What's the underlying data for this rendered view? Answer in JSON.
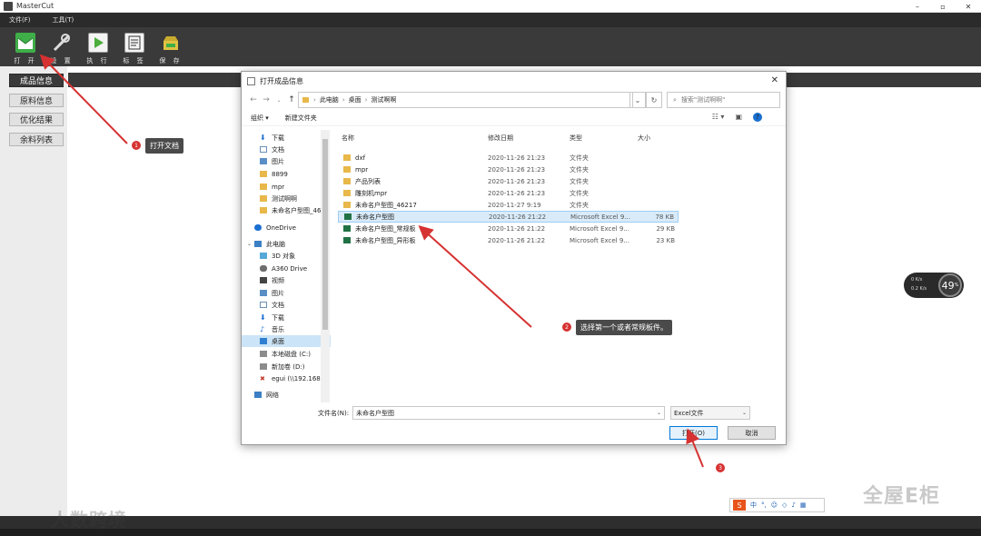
{
  "window": {
    "title": "MasterCut",
    "controls": [
      "–",
      "▫",
      "✕"
    ]
  },
  "menu": {
    "items": [
      "文件(F)",
      "工具(T)"
    ]
  },
  "toolbar": {
    "items": [
      {
        "label": "打 开",
        "icon": "open-icon",
        "color": "#3fae49"
      },
      {
        "label": "设 置",
        "icon": "tools-icon",
        "color": "#d9d9d9"
      },
      {
        "label": "执 行",
        "icon": "play-icon",
        "color": "#5fbf4a"
      },
      {
        "label": "标 签",
        "icon": "label-icon",
        "color": "#d9d9d9"
      },
      {
        "label": "保 存",
        "icon": "save-icon",
        "color": "#e0c341"
      }
    ]
  },
  "leftnav": {
    "items": [
      "成品信息",
      "原料信息",
      "优化结果",
      "余料列表"
    ]
  },
  "annotations": {
    "open_doc": "打开文档",
    "select_first": "选择第一个或者常规板件。",
    "step1": "1",
    "step2": "2",
    "step3": "3"
  },
  "gauge": {
    "up": "0",
    "up_unit": "K/s",
    "down": "0.2",
    "down_unit": "K/s",
    "percent": "49",
    "percent_unit": "%"
  },
  "dialog": {
    "title": "打开成品信息",
    "breadcrumbs": [
      "此电脑",
      "桌面",
      "测试啊啊"
    ],
    "search_placeholder": "搜索\"测试啊啊\"",
    "organize": "组织 ▾",
    "new_folder": "新建文件夹",
    "nav": [
      {
        "label": "下载",
        "icon": "download-icon",
        "pinned": true
      },
      {
        "label": "文档",
        "icon": "document-icon",
        "pinned": true
      },
      {
        "label": "图片",
        "icon": "picture-icon",
        "pinned": true
      },
      {
        "label": "8899",
        "icon": "folder-icon",
        "pinned": false
      },
      {
        "label": "mpr",
        "icon": "folder-icon",
        "pinned": false
      },
      {
        "label": "测试啊啊",
        "icon": "folder-icon",
        "pinned": false
      },
      {
        "label": "未命名户型图_46",
        "icon": "folder-icon",
        "pinned": false
      },
      {
        "label": "OneDrive",
        "icon": "cloud-icon",
        "pinned": false
      },
      {
        "label": "此电脑",
        "icon": "computer-icon",
        "pinned": false
      },
      {
        "label": "3D 对象",
        "icon": "cube-icon",
        "pinned": false
      },
      {
        "label": "A360 Drive",
        "icon": "drive-icon",
        "pinned": false
      },
      {
        "label": "视频",
        "icon": "video-icon",
        "pinned": false
      },
      {
        "label": "图片",
        "icon": "picture-icon",
        "pinned": false
      },
      {
        "label": "文档",
        "icon": "document-icon",
        "pinned": false
      },
      {
        "label": "下载",
        "icon": "download-icon",
        "pinned": false
      },
      {
        "label": "音乐",
        "icon": "music-icon",
        "pinned": false
      },
      {
        "label": "桌面",
        "icon": "desktop-icon",
        "pinned": false
      },
      {
        "label": "本地磁盘 (C:)",
        "icon": "disk-icon",
        "pinned": false
      },
      {
        "label": "新加卷 (D:)",
        "icon": "disk-icon",
        "pinned": false
      },
      {
        "label": "egui (\\\\192.168.",
        "icon": "network-drive-icon",
        "pinned": false
      },
      {
        "label": "网络",
        "icon": "network-icon",
        "pinned": false
      }
    ],
    "columns": {
      "name": "名称",
      "date": "修改日期",
      "type": "类型",
      "size": "大小"
    },
    "files": [
      {
        "name": "dxf",
        "date": "2020-11-26 21:23",
        "type": "文件夹",
        "size": "",
        "kind": "folder"
      },
      {
        "name": "mpr",
        "date": "2020-11-26 21:23",
        "type": "文件夹",
        "size": "",
        "kind": "folder"
      },
      {
        "name": "产品列表",
        "date": "2020-11-26 21:23",
        "type": "文件夹",
        "size": "",
        "kind": "folder"
      },
      {
        "name": "雕刻机mpr",
        "date": "2020-11-26 21:23",
        "type": "文件夹",
        "size": "",
        "kind": "folder"
      },
      {
        "name": "未命名户型图_46217",
        "date": "2020-11-27 9:19",
        "type": "文件夹",
        "size": "",
        "kind": "folder"
      },
      {
        "name": "未命名户型图",
        "date": "2020-11-26 21:22",
        "type": "Microsoft Excel 9...",
        "size": "78 KB",
        "kind": "excel"
      },
      {
        "name": "未命名户型图_常规板",
        "date": "2020-11-26 21:22",
        "type": "Microsoft Excel 9...",
        "size": "29 KB",
        "kind": "excel"
      },
      {
        "name": "未命名户型图_异形板",
        "date": "2020-11-26 21:22",
        "type": "Microsoft Excel 9...",
        "size": "23 KB",
        "kind": "excel"
      }
    ],
    "filename_label": "文件名(N):",
    "filename_value": "未命名户型图",
    "filetype_value": "Excel文件",
    "open_button": "打开(O)",
    "cancel_button": "取消"
  },
  "tray": {
    "items": [
      "中",
      "°,",
      "☺",
      "◇",
      "♪",
      "▦"
    ]
  },
  "watermarks": {
    "left": "人数跨境",
    "right": "全屋E柜"
  },
  "colors": {
    "accent_blue": "#0078d7",
    "annotation_red": "#d63232",
    "folder_yellow": "#e8b84a",
    "excel_green": "#207245"
  }
}
